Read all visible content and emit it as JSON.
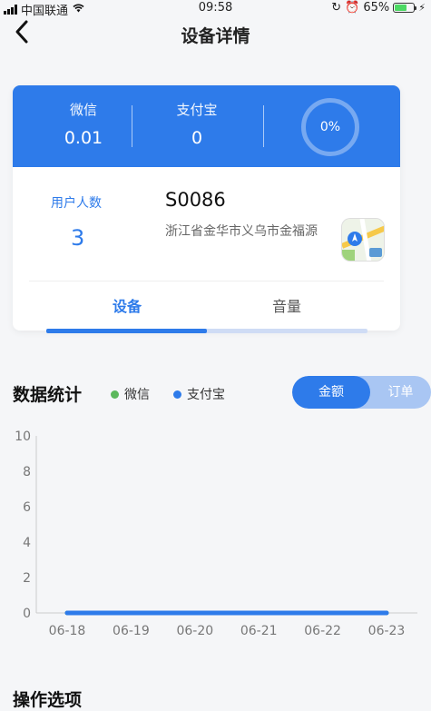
{
  "status_bar": {
    "carrier": "中国联通",
    "time": "09:58",
    "battery": "65%"
  },
  "nav": {
    "title": "设备详情"
  },
  "stats": {
    "wechat": {
      "label": "微信",
      "value": "0.01"
    },
    "alipay": {
      "label": "支付宝",
      "value": "0"
    },
    "progress": "0%"
  },
  "device": {
    "users_label": "用户人数",
    "users_count": "3",
    "id": "S0086",
    "address": "浙江省金华市义乌市金福源"
  },
  "tabs": [
    {
      "label": "设备",
      "active": true
    },
    {
      "label": "音量",
      "active": false
    }
  ],
  "stats_section": {
    "title": "数据统计",
    "legend": [
      {
        "label": "微信",
        "color": "#5cb85c"
      },
      {
        "label": "支付宝",
        "color": "#2e7bea"
      }
    ],
    "toggle": [
      "金额",
      "订单"
    ]
  },
  "chart_data": {
    "type": "line",
    "categories": [
      "06-18",
      "06-19",
      "06-20",
      "06-21",
      "06-22",
      "06-23"
    ],
    "series": [
      {
        "name": "微信",
        "values": [
          0,
          0,
          0,
          0,
          0,
          0
        ]
      },
      {
        "name": "支付宝",
        "values": [
          0,
          0,
          0,
          0,
          0,
          0
        ]
      }
    ],
    "yticks": [
      0,
      2,
      4,
      6,
      8,
      10
    ],
    "ylim": [
      0,
      10
    ],
    "grid": false
  },
  "ops": {
    "title": "操作选项"
  },
  "colors": {
    "accent": "#2e7bea",
    "wechat": "#5cb85c"
  }
}
